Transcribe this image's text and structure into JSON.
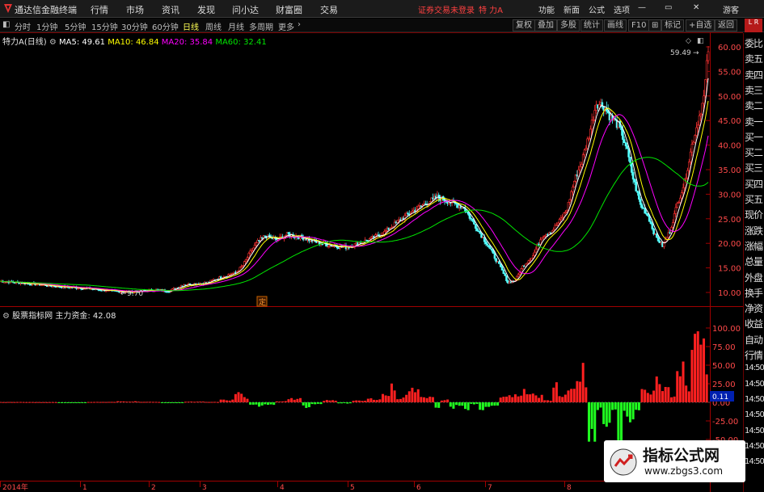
{
  "menu": {
    "app_name": "通达信金融终端",
    "items": [
      "行情",
      "市场",
      "资讯",
      "发现",
      "问小达",
      "财富圈",
      "交易"
    ],
    "login_status": "证券交易未登录",
    "stock_title": "特 力A",
    "right_items": [
      "功能",
      "新面",
      "公式",
      "选项"
    ],
    "guest": "游客"
  },
  "periods": {
    "items": [
      "分时",
      "1分钟",
      "5分钟",
      "15分钟",
      "30分钟",
      "60分钟",
      "日线",
      "周线",
      "月线",
      "多周期",
      "更多"
    ],
    "active": "日线",
    "more_arrow": "›",
    "tools": [
      "复权",
      "叠加",
      "多股",
      "统计",
      "画线",
      "F10",
      "标记",
      "+自选",
      "返回"
    ],
    "lr_badge": "L R"
  },
  "main_info": {
    "stock": "特力A",
    "period": "(日线)",
    "ma5": "MA5: 49.61",
    "ma10": "MA10: 46.84",
    "ma20": "MA20: 35.84",
    "ma60": "MA60: 32.41"
  },
  "sub_info": {
    "source": "股票指标网",
    "name": "主力资金: 42.08"
  },
  "annotations": {
    "low": "9.70",
    "high": "59.49",
    "marker": "定",
    "current_value": "0.11"
  },
  "price_axis": [
    "60.00",
    "55.00",
    "50.00",
    "45.00",
    "40.00",
    "35.00",
    "30.00",
    "25.00",
    "20.00",
    "15.00",
    "10.00"
  ],
  "indicator_axis": [
    "100.00",
    "75.00",
    "50.00",
    "25.00",
    "0.00",
    "-25.00",
    "-50.00"
  ],
  "date_axis": [
    "2014年",
    "1",
    "2",
    "3",
    "4",
    "5",
    "6",
    "7",
    "8"
  ],
  "side_panel": [
    "委比",
    "卖五",
    "卖四",
    "卖三",
    "卖二",
    "卖一",
    "买一",
    "买二",
    "买三",
    "买四",
    "买五",
    "现价",
    "涨跌",
    "涨幅",
    "总量",
    "外盘",
    "换手",
    "净资",
    "收益",
    "自动",
    "行情",
    "14:50",
    "14:50",
    "14:50",
    "14:50",
    "14:50",
    "14:50",
    "14:50"
  ],
  "watermark": {
    "title": "指标公式网",
    "url": "www.zbgs3.com"
  },
  "colors": {
    "up": "#ff3232",
    "down": "#54ffff",
    "ma5": "#ffffff",
    "ma10": "#ffff00",
    "ma20": "#ff00ff",
    "ma60": "#00e600",
    "bar_up": "#ff2020",
    "bar_down": "#20ff20",
    "axis_red": "#a00000"
  },
  "chart_data": [
    {
      "type": "candlestick",
      "title": "特力A (日线)",
      "ylim": [
        8,
        62
      ],
      "x_ticks": [
        "2014年",
        "1",
        "2",
        "3",
        "4",
        "5",
        "6",
        "7",
        "8"
      ],
      "y_ticks": [
        10,
        15,
        20,
        25,
        30,
        35,
        40,
        45,
        50,
        55,
        60
      ],
      "close_trend": [
        [
          0,
          12.3
        ],
        [
          20,
          11.8
        ],
        [
          40,
          11.2
        ],
        [
          60,
          10.8
        ],
        [
          75,
          10.3
        ],
        [
          90,
          10.1
        ],
        [
          105,
          10.5
        ],
        [
          115,
          10.3
        ],
        [
          125,
          11.6
        ],
        [
          140,
          11.9
        ],
        [
          150,
          13.1
        ],
        [
          160,
          14.0
        ],
        [
          165,
          15.5
        ],
        [
          170,
          18.2
        ],
        [
          175,
          20.3
        ],
        [
          180,
          21.5
        ],
        [
          188,
          20.7
        ],
        [
          195,
          21.8
        ],
        [
          205,
          21.2
        ],
        [
          215,
          20.2
        ],
        [
          225,
          19.6
        ],
        [
          235,
          19.2
        ],
        [
          240,
          19.6
        ],
        [
          250,
          20.7
        ],
        [
          260,
          22.0
        ],
        [
          270,
          24.4
        ],
        [
          280,
          26.5
        ],
        [
          290,
          28.3
        ],
        [
          297,
          29.4
        ],
        [
          305,
          28.5
        ],
        [
          315,
          27.3
        ],
        [
          322,
          23.9
        ],
        [
          332,
          19.3
        ],
        [
          340,
          15.0
        ],
        [
          345,
          12.0
        ],
        [
          350,
          12.5
        ],
        [
          355,
          15.3
        ],
        [
          362,
          17.5
        ],
        [
          368,
          21.5
        ],
        [
          375,
          22.6
        ],
        [
          380,
          24.5
        ],
        [
          385,
          26.9
        ],
        [
          390,
          32.7
        ],
        [
          395,
          36.5
        ],
        [
          400,
          42.0
        ],
        [
          405,
          48.6
        ],
        [
          410,
          48.0
        ],
        [
          415,
          45.5
        ],
        [
          420,
          44.0
        ],
        [
          425,
          40.0
        ],
        [
          430,
          33.2
        ],
        [
          435,
          27.8
        ],
        [
          440,
          25.7
        ],
        [
          445,
          21.5
        ],
        [
          450,
          19.5
        ],
        [
          455,
          22.5
        ],
        [
          460,
          28.0
        ],
        [
          465,
          32.5
        ],
        [
          470,
          40.0
        ],
        [
          475,
          46.0
        ],
        [
          478,
          49.6
        ],
        [
          481,
          59.49
        ]
      ],
      "low": 9.7,
      "high": 59.49,
      "series": [
        {
          "name": "MA5",
          "value": 49.61
        },
        {
          "name": "MA10",
          "value": 46.84
        },
        {
          "name": "MA20",
          "value": 35.84
        },
        {
          "name": "MA60",
          "value": 32.41
        }
      ]
    },
    {
      "type": "bar",
      "title": "主力资金",
      "value": 42.08,
      "ylim": [
        -55,
        112
      ],
      "y_ticks": [
        100,
        75,
        50,
        25,
        0,
        -25,
        -50
      ],
      "values": [
        [
          0,
          0.4
        ],
        [
          20,
          0.3
        ],
        [
          40,
          -0.6
        ],
        [
          60,
          0.5
        ],
        [
          80,
          1.2
        ],
        [
          95,
          0.6
        ],
        [
          110,
          -0.5
        ],
        [
          125,
          0.8
        ],
        [
          140,
          0.5
        ],
        [
          150,
          3.0
        ],
        [
          160,
          12.0
        ],
        [
          165,
          6.0
        ],
        [
          170,
          -2.5
        ],
        [
          175,
          -5.0
        ],
        [
          180,
          -3.5
        ],
        [
          188,
          1.5
        ],
        [
          195,
          4.5
        ],
        [
          205,
          -6.0
        ],
        [
          212,
          -2.0
        ],
        [
          220,
          2.5
        ],
        [
          230,
          -1.5
        ],
        [
          240,
          2.0
        ],
        [
          250,
          4.5
        ],
        [
          260,
          10.0
        ],
        [
          265,
          20.0
        ],
        [
          270,
          5.5
        ],
        [
          275,
          12.0
        ],
        [
          280,
          18.0
        ],
        [
          285,
          9.0
        ],
        [
          290,
          6.5
        ],
        [
          295,
          -6.0
        ],
        [
          300,
          3.0
        ],
        [
          305,
          -8.0
        ],
        [
          310,
          -4.0
        ],
        [
          315,
          -9.5
        ],
        [
          320,
          -2.5
        ],
        [
          325,
          -10.5
        ],
        [
          330,
          -5.0
        ],
        [
          335,
          -3.5
        ],
        [
          340,
          6.0
        ],
        [
          345,
          8.5
        ],
        [
          350,
          11.0
        ],
        [
          355,
          15.0
        ],
        [
          360,
          12.0
        ],
        [
          365,
          8.5
        ],
        [
          370,
          2.5
        ],
        [
          375,
          24.0
        ],
        [
          380,
          10.0
        ],
        [
          385,
          20.5
        ],
        [
          388,
          17.0
        ],
        [
          392,
          30.5
        ],
        [
          395,
          59.5
        ],
        [
          397,
          21.0
        ],
        [
          400,
          -48.0
        ],
        [
          405,
          -8.0
        ],
        [
          410,
          -29.0
        ],
        [
          415,
          -11.0
        ],
        [
          420,
          -50.0
        ],
        [
          423,
          -15.0
        ],
        [
          428,
          -22.0
        ],
        [
          432,
          -12.0
        ],
        [
          436,
          23.0
        ],
        [
          440,
          13.0
        ],
        [
          445,
          31.0
        ],
        [
          450,
          21.0
        ],
        [
          455,
          9.5
        ],
        [
          460,
          42.0
        ],
        [
          463,
          64.0
        ],
        [
          466,
          20.0
        ],
        [
          470,
          92.0
        ],
        [
          473,
          75.0
        ],
        [
          476,
          98.0
        ],
        [
          480,
          42.08
        ]
      ]
    }
  ]
}
